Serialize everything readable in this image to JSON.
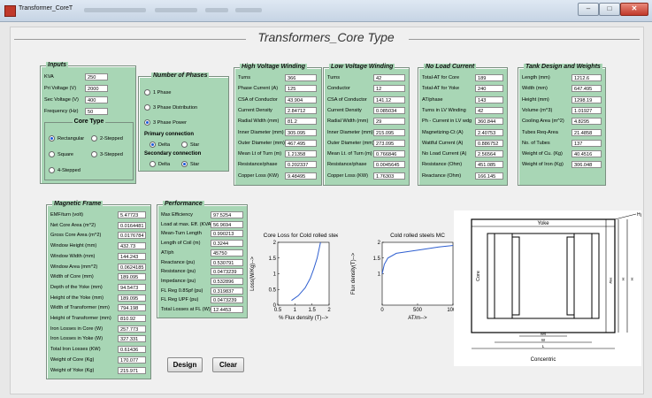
{
  "window": {
    "title": "Transformer_CoreT"
  },
  "main_title": "Transformers_Core Type",
  "inputs": {
    "title": "Inputs",
    "fields": [
      {
        "label": "KVA",
        "value": "250"
      },
      {
        "label": "Pri Voltage (V)",
        "value": "2000"
      },
      {
        "label": "Sec Voltage (V)",
        "value": "400"
      },
      {
        "label": "Frequency (Hz)",
        "value": "50"
      }
    ],
    "core_type": {
      "title": "Core Type",
      "options": [
        "Rectangular",
        "2-Stepped",
        "Square",
        "3-Stepped",
        "4-Stepped"
      ],
      "selected": "Rectangular"
    }
  },
  "phases": {
    "title": "Number of Phases",
    "options": [
      "1 Phase",
      "3 Phase Distribution",
      "3 Phase Power"
    ],
    "selected": "3 Phase Power",
    "primary": {
      "title": "Primary connection",
      "options": [
        "Delta",
        "Star"
      ],
      "selected": "Delta"
    },
    "secondary": {
      "title": "Secondary connection",
      "options": [
        "Delta",
        "Star"
      ],
      "selected": "Star"
    }
  },
  "hv": {
    "title": "High Voltage Winding",
    "rows": [
      {
        "label": "Turns",
        "value": "366"
      },
      {
        "label": "Phase Current (A)",
        "value": "125"
      },
      {
        "label": "CSA of Conductor",
        "value": "43.904"
      },
      {
        "label": "Current Density",
        "value": "2.84712"
      },
      {
        "label": "Radial Width (mm)",
        "value": "81.2"
      },
      {
        "label": "Inner Diameter (mm)",
        "value": "305.095"
      },
      {
        "label": "Outer Diameter (mm)",
        "value": "467.495"
      },
      {
        "label": "Mean Lt of Turn (m)",
        "value": "1.21358"
      },
      {
        "label": "Resistance/phase",
        "value": "0.202337"
      },
      {
        "label": "Copper Loss (KW)",
        "value": "9.48495"
      }
    ]
  },
  "lv": {
    "title": "Low Voltage Winding",
    "rows": [
      {
        "label": "Turns",
        "value": "42"
      },
      {
        "label": "Conductor",
        "value": "12"
      },
      {
        "label": "CSA of Conductor",
        "value": "141.12"
      },
      {
        "label": "Current Density",
        "value": "0.085034"
      },
      {
        "label": "Radial Width (mm)",
        "value": "29"
      },
      {
        "label": "Inner Diameter (mm)",
        "value": "215.095"
      },
      {
        "label": "Outer Diameter (mm)",
        "value": "273.095"
      },
      {
        "label": "Mean Lt. of Turn (m)",
        "value": "0.766846"
      },
      {
        "label": "Resistance/phase",
        "value": "0.0045645"
      },
      {
        "label": "Copper Loss (KW)",
        "value": "1.76303"
      }
    ]
  },
  "nl": {
    "title": "No Load Current",
    "rows": [
      {
        "label": "Total-AT for Core",
        "value": "189"
      },
      {
        "label": "Total-AT for Yoke",
        "value": "240"
      },
      {
        "label": "AT/phase",
        "value": "143"
      },
      {
        "label": "Turns in LV Winding",
        "value": "42"
      },
      {
        "label": "Ph - Current in LV wdg",
        "value": "360.844"
      },
      {
        "label": "Magnetizing-Ct (A)",
        "value": "2.40753"
      },
      {
        "label": "Wattful Current (A)",
        "value": "0.886752"
      },
      {
        "label": "No Load Current (A)",
        "value": "2.56564"
      },
      {
        "label": "Resistance (Ohm)",
        "value": "451.085"
      },
      {
        "label": "Reactance (Ohm)",
        "value": "166.145"
      }
    ]
  },
  "tank": {
    "title": "Tank Design and Weights",
    "rows": [
      {
        "label": "Length (mm)",
        "value": "1212.6"
      },
      {
        "label": "Width (mm)",
        "value": "647.495"
      },
      {
        "label": "Height (mm)",
        "value": "1298.19"
      },
      {
        "label": "Volume (m^3)",
        "value": "1.01927"
      },
      {
        "label": "Cooling Area (m^2)",
        "value": "4.8295"
      },
      {
        "label": "Tubes Req-Area",
        "value": "21.4858"
      },
      {
        "label": "No. of Tubes",
        "value": "137"
      },
      {
        "label": "Weight of Cu. (Kg)",
        "value": "40.4516"
      },
      {
        "label": "Weight of Iron (Kg)",
        "value": "306.048"
      }
    ]
  },
  "mag": {
    "title": "Magnetic Frame",
    "rows": [
      {
        "label": "EMF/turn (volt)",
        "value": "5.47723"
      },
      {
        "label": "Net Core Area (m^2)",
        "value": "0.0164481"
      },
      {
        "label": "Gross Core Area (m^2)",
        "value": "0.0176784"
      },
      {
        "label": "Window Height (mm)",
        "value": "432.73"
      },
      {
        "label": "Window Width (mm)",
        "value": "144.243"
      },
      {
        "label": "Window Area (mm^2)",
        "value": "0.0624185"
      },
      {
        "label": "Width of Core (mm)",
        "value": "189.095"
      },
      {
        "label": "Depth of the Yoke (mm)",
        "value": "94.5473"
      },
      {
        "label": "Height of the Yoke (mm)",
        "value": "189.095"
      },
      {
        "label": "Width of Transformer (mm)",
        "value": "794.198"
      },
      {
        "label": "Height of Transformer (mm)",
        "value": "810.92"
      },
      {
        "label": "Iron Losses in Core (W)",
        "value": "257.773"
      },
      {
        "label": "Iron Losses in Yoke (W)",
        "value": "327.331"
      },
      {
        "label": "Total Iron Losses (KW)",
        "value": "0.61436"
      },
      {
        "label": "Weight of Core (Kg)",
        "value": "170.077"
      },
      {
        "label": "Weight of Yoke (Kg)",
        "value": "215.971"
      }
    ]
  },
  "perf": {
    "title": "Performance",
    "rows": [
      {
        "label": "Max Efficiency",
        "value": "97.5254"
      },
      {
        "label": "Load at max. Eff. (KVA)",
        "value": "56.9694"
      },
      {
        "label": "Mean-Turn Length",
        "value": "0.990213"
      },
      {
        "label": "Length of Coil (m)",
        "value": "0.3244"
      },
      {
        "label": "AT/ph",
        "value": "45750"
      },
      {
        "label": "Reactance (pu)",
        "value": "0.530791"
      },
      {
        "label": "Resistance (pu)",
        "value": "0.0473239"
      },
      {
        "label": "Impedance (pu)",
        "value": "0.532896"
      },
      {
        "label": "FL Reg 0.8Spf (pu)",
        "value": "0.319837"
      },
      {
        "label": "FL Reg UPF (pu)",
        "value": "0.0473239"
      },
      {
        "label": "Total Losses at FL (W)",
        "value": "12.4453"
      }
    ]
  },
  "buttons": {
    "design": "Design",
    "clear": "Clear"
  },
  "chart_data": [
    {
      "type": "line",
      "title": "Core Loss for Cold rolled steels",
      "xlabel": "% Flux density (T)-->",
      "ylabel": "Loss(W/Kg)-->",
      "xlim": [
        0.5,
        2
      ],
      "ylim": [
        0,
        2
      ],
      "xticks": [
        "0.5",
        "1",
        "1.5",
        "2"
      ],
      "yticks": [
        "0",
        "0.5",
        "1",
        "1.5",
        "2"
      ],
      "x": [
        0.9,
        1.1,
        1.3,
        1.45,
        1.55,
        1.65,
        1.75
      ],
      "y": [
        0.15,
        0.3,
        0.55,
        0.85,
        1.15,
        1.5,
        2.0
      ]
    },
    {
      "type": "line",
      "title": "Cold rolled steels MC",
      "xlabel": "AT/m-->",
      "ylabel": "Flux density(T)-->",
      "xlim": [
        0,
        1000
      ],
      "ylim": [
        0,
        2
      ],
      "xticks": [
        "0",
        "500",
        "1000"
      ],
      "yticks": [
        "1",
        "1.5",
        "2"
      ],
      "x": [
        0,
        30,
        80,
        200,
        500,
        800,
        1000
      ],
      "y": [
        1.0,
        1.3,
        1.5,
        1.65,
        1.75,
        1.85,
        1.9
      ]
    }
  ],
  "diagram": {
    "yoke_label": "Yoke",
    "core_label": "Core",
    "caption": "Concentric",
    "ht_label": "Hy",
    "ws_label": "Ws",
    "w_label": "W",
    "wl_label": "L",
    "hw_label": "Hw",
    "h_label": "H"
  }
}
